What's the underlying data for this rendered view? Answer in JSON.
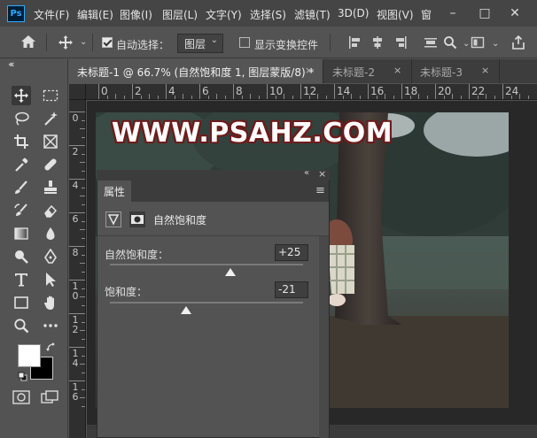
{
  "menubar": {
    "logo": "Ps",
    "items": [
      "文件(F)",
      "编辑(E)",
      "图像(I)",
      "图层(L)",
      "文字(Y)",
      "选择(S)",
      "滤镜(T)",
      "3D(D)",
      "视图(V)",
      "窗"
    ],
    "min": "–",
    "max": "□",
    "close": "✕"
  },
  "options": {
    "auto_select_label": "自动选择：",
    "auto_select_checked": true,
    "layer_select_value": "图层",
    "show_transform_label": "显示变换控件",
    "show_transform_checked": false
  },
  "toolbar": {
    "collapse": "«"
  },
  "tabs": {
    "collapse": "«",
    "items": [
      {
        "label": "未标题-1 @ 66.7% (自然饱和度 1, 图层蒙版/8) *",
        "active": true
      },
      {
        "label": "未标题-2",
        "active": false
      },
      {
        "label": "未标题-3",
        "active": false
      }
    ],
    "close": "×"
  },
  "ruler": {
    "h": [
      "0",
      "2",
      "4",
      "6",
      "8",
      "10",
      "12",
      "14",
      "16",
      "18",
      "20",
      "22",
      "24"
    ],
    "v": [
      [
        "0"
      ],
      [
        "2"
      ],
      [
        "4"
      ],
      [
        "6"
      ],
      [
        "8"
      ],
      [
        "1",
        "0"
      ],
      [
        "1",
        "2"
      ],
      [
        "1",
        "4"
      ],
      [
        "1",
        "6"
      ]
    ]
  },
  "canvas": {
    "watermark": "WWW.PSAHZ.COM"
  },
  "panel": {
    "collapse": "«",
    "close": "×",
    "tab": "属性",
    "menu": "≡",
    "adjustment_name": "自然饱和度",
    "vibrance_label": "自然饱和度：",
    "vibrance_value": "+25",
    "vibrance_level": 25,
    "saturation_label": "饱和度：",
    "saturation_value": "-21",
    "saturation_level": -21
  },
  "colors": {
    "foreground": "#ffffff",
    "background": "#000000",
    "accent": "#31a8ff"
  }
}
